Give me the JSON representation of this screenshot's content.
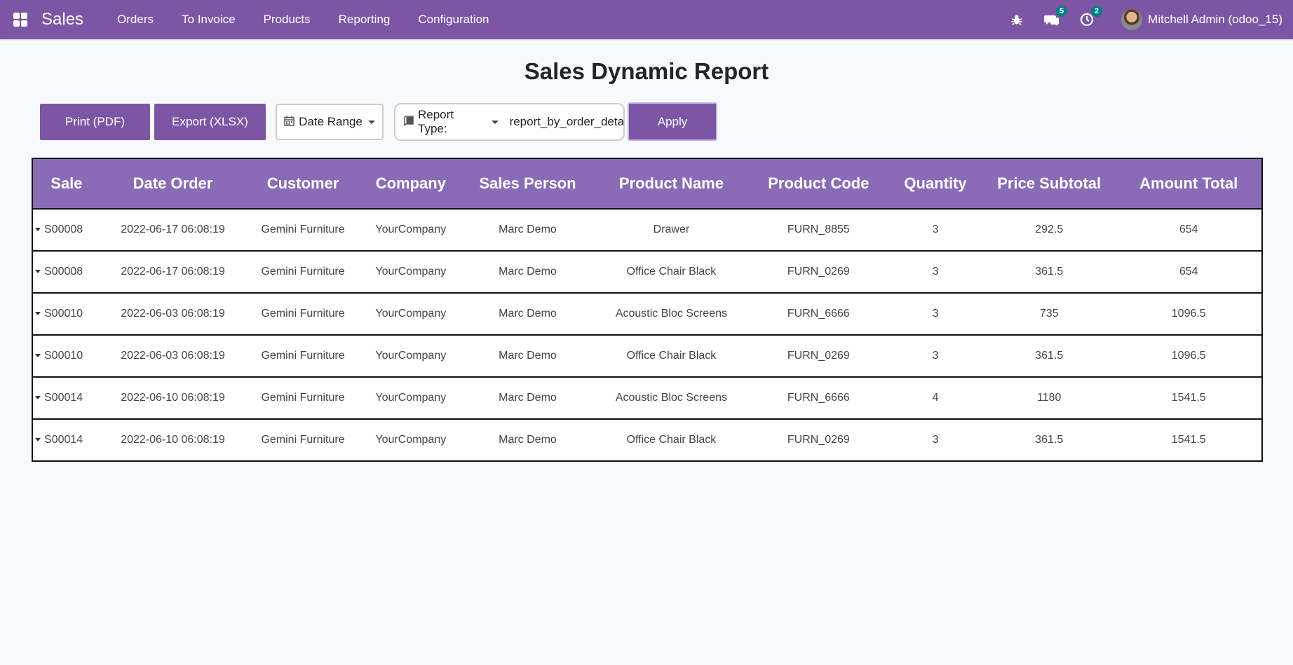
{
  "navbar": {
    "brand": "Sales",
    "menu": [
      "Orders",
      "To Invoice",
      "Products",
      "Reporting",
      "Configuration"
    ],
    "messages_badge": "5",
    "activities_badge": "2",
    "user_name": "Mitchell Admin (odoo_15)",
    "icons": [
      "apps-grid-icon",
      "bug-icon",
      "chat-icon",
      "clock-icon"
    ],
    "bg_color": "#7c56a4"
  },
  "page": {
    "title": "Sales Dynamic Report"
  },
  "toolbar": {
    "print_label": "Print (PDF)",
    "export_label": "Export (XLSX)",
    "date_range_label": "Date Range",
    "report_type_label": "Report Type:",
    "report_type_value": "report_by_order_detail",
    "apply_label": "Apply"
  },
  "table": {
    "header_color": "#8a6bb6",
    "columns": [
      "Sale",
      "Date Order",
      "Customer",
      "Company",
      "Sales Person",
      "Product Name",
      "Product Code",
      "Quantity",
      "Price Subtotal",
      "Amount Total"
    ],
    "rows": [
      [
        "S00008",
        "2022-06-17 06:08:19",
        "Gemini Furniture",
        "YourCompany",
        "Marc Demo",
        "Drawer",
        "FURN_8855",
        "3",
        "292.5",
        "654"
      ],
      [
        "S00008",
        "2022-06-17 06:08:19",
        "Gemini Furniture",
        "YourCompany",
        "Marc Demo",
        "Office Chair Black",
        "FURN_0269",
        "3",
        "361.5",
        "654"
      ],
      [
        "S00010",
        "2022-06-03 06:08:19",
        "Gemini Furniture",
        "YourCompany",
        "Marc Demo",
        "Acoustic Bloc Screens",
        "FURN_6666",
        "3",
        "735",
        "1096.5"
      ],
      [
        "S00010",
        "2022-06-03 06:08:19",
        "Gemini Furniture",
        "YourCompany",
        "Marc Demo",
        "Office Chair Black",
        "FURN_0269",
        "3",
        "361.5",
        "1096.5"
      ],
      [
        "S00014",
        "2022-06-10 06:08:19",
        "Gemini Furniture",
        "YourCompany",
        "Marc Demo",
        "Acoustic Bloc Screens",
        "FURN_6666",
        "4",
        "1180",
        "1541.5"
      ],
      [
        "S00014",
        "2022-06-10 06:08:19",
        "Gemini Furniture",
        "YourCompany",
        "Marc Demo",
        "Office Chair Black",
        "FURN_0269",
        "3",
        "361.5",
        "1541.5"
      ]
    ]
  }
}
